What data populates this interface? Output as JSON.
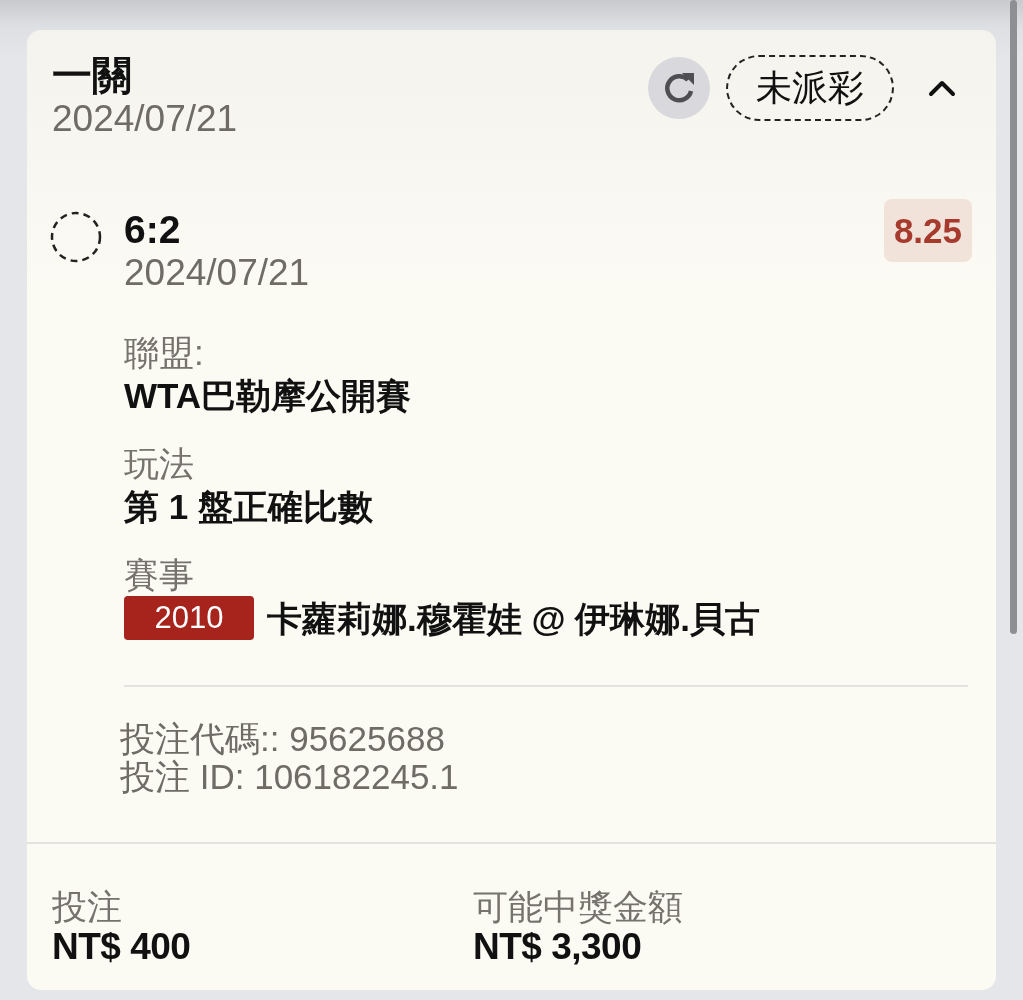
{
  "bet": {
    "type": "一關",
    "date": "2024/07/21",
    "status": "未派彩",
    "expanded": true
  },
  "selection": {
    "pick": "6:2",
    "date": "2024/07/21",
    "odds": "8.25",
    "settled": false
  },
  "details": [
    {
      "kind": "text",
      "label": "聯盟:",
      "value": "WTA巴勒摩公開賽"
    },
    {
      "kind": "text",
      "label": "玩法",
      "value": "第 1 盤正確比數"
    },
    {
      "kind": "event",
      "label": "賽事",
      "event_code": "2010",
      "value": "卡蘿莉娜.穆霍娃 @ 伊琳娜.貝古"
    }
  ],
  "references": [
    "投注代碼:: 95625688",
    "投注 ID: 106182245.1"
  ],
  "totals": [
    {
      "label": "投注",
      "amount": "NT$ 400"
    },
    {
      "label": "可能中獎金額",
      "amount": "NT$ 3,300"
    }
  ]
}
